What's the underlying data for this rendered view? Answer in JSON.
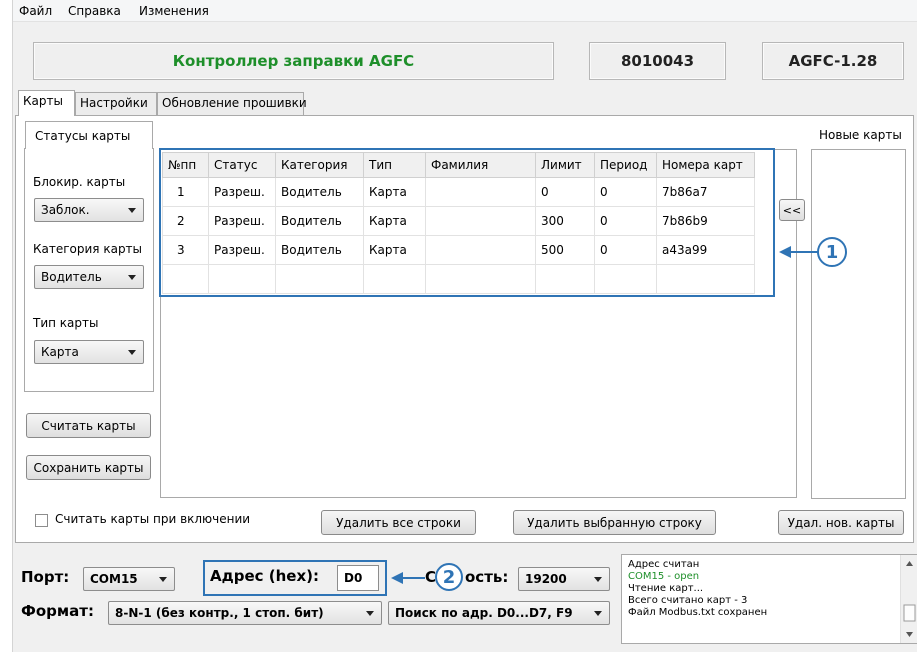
{
  "menu": [
    "Файл",
    "Справка",
    "Изменения"
  ],
  "header": {
    "title": "Контроллер заправки AGFC",
    "serial": "8010043",
    "version": "AGFC-1.28"
  },
  "tabs": [
    "Карты",
    "Настройки",
    "Обновление прошивки"
  ],
  "status_tab": "Статусы карты",
  "new_cards_label": "Новые карты",
  "filters": {
    "block_label": "Блокир. карты",
    "block_value": "Заблок.",
    "category_label": "Категория карты",
    "category_value": "Водитель",
    "type_label": "Тип карты",
    "type_value": "Карта"
  },
  "buttons": {
    "read_cards": "Считать карты",
    "save_cards": "Сохранить карты",
    "move_left": "<<",
    "delete_all": "Удалить все строки",
    "delete_selected": "Удалить выбранную строку",
    "delete_new": "Удал. нов. карты"
  },
  "read_on_start": "Считать карты при включении",
  "table": {
    "headers": [
      "№пп",
      "Статус",
      "Категория",
      "Тип",
      "Фамилия",
      "Лимит",
      "Период",
      "Номера карт"
    ],
    "rows": [
      [
        "1",
        "Разреш.",
        "Водитель",
        "Карта",
        "",
        "0",
        "0",
        "7b86a7"
      ],
      [
        "2",
        "Разреш.",
        "Водитель",
        "Карта",
        "",
        "300",
        "0",
        "7b86b9"
      ],
      [
        "3",
        "Разреш.",
        "Водитель",
        "Карта",
        "",
        "500",
        "0",
        "a43a99"
      ]
    ]
  },
  "callouts": [
    "1",
    "2"
  ],
  "connection": {
    "port_label": "Порт:",
    "port_value": "COM15",
    "address_label": "Адрес (hex):",
    "address_value": "D0",
    "speed_label_left": "С",
    "speed_label_right": "ость:",
    "speed_value": "19200",
    "format_label": "Формат:",
    "format_value": "8-N-1 (без контр., 1 стоп. бит)",
    "search_value": "Поиск по адр. D0...D7, F9"
  },
  "log": [
    {
      "text": "Адрес считан",
      "color": "#000000"
    },
    {
      "text": "COM15 - open",
      "color": "#1e8f2a"
    },
    {
      "text": "Чтение карт...",
      "color": "#000000"
    },
    {
      "text": "Всего считано карт - 3",
      "color": "#000000"
    },
    {
      "text": "Файл Modbus.txt сохранен",
      "color": "#000000"
    }
  ],
  "colors": {
    "accent": "#2f74b5",
    "title_green": "#1e8f2a"
  }
}
